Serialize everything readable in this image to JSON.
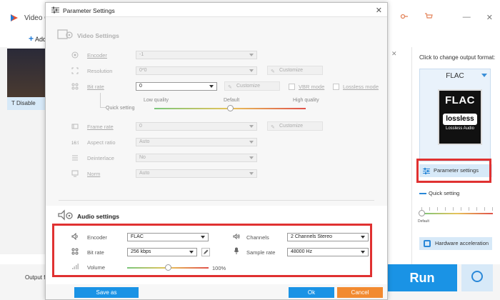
{
  "app": {
    "title": "Video C",
    "add_label": "Add",
    "disable_label": "Disable",
    "output_label": "Output fo",
    "run_label": "Run"
  },
  "right_panel": {
    "change_format_label": "Click to change output format:",
    "format_name": "FLAC",
    "format_icon_top": "FLAC",
    "format_icon_mid": "lossless",
    "format_icon_bottom": "Lossless Audio",
    "parameter_settings_label": "Parameter settings",
    "quick_setting_label": "Quick setting",
    "slider_default_label": "Default",
    "hardware_accel_label": "Hardware acceleration"
  },
  "dialog": {
    "title": "Parameter Settings",
    "close": "✕",
    "video": {
      "section_title": "Video Settings",
      "encoder_label": "Encoder",
      "encoder_value": "-1",
      "resolution_label": "Resolution",
      "resolution_value": "0*0",
      "resolution_customize": "Customize",
      "bitrate_label": "Bit rate",
      "bitrate_value": "0",
      "bitrate_customize": "Customize",
      "vbr_label": "VBR mode",
      "lossless_label": "Lossless mode",
      "quality_low": "Low quality",
      "quality_default": "Default",
      "quality_high": "High quality",
      "quick_setting_label": "Quick setting",
      "quick_setting_level": 0.5,
      "framerate_label": "Frame rate",
      "framerate_value": "0",
      "framerate_customize": "Customize",
      "aspect_label": "Aspect ratio",
      "aspect_value": "Auto",
      "deinterlace_label": "Deinterlace",
      "deinterlace_value": "No",
      "norm_label": "Norm",
      "norm_value": "Auto"
    },
    "audio": {
      "section_title": "Audio settings",
      "encoder_label": "Encoder",
      "encoder_value": "FLAC",
      "channels_label": "Channels",
      "channels_value": "2 Channels Stereo",
      "bitrate_label": "Bit rate",
      "bitrate_value": "256 kbps",
      "samplerate_label": "Sample rate",
      "samplerate_value": "48000 Hz",
      "volume_label": "Volume",
      "volume_value": "100%",
      "volume_level": 0.5
    },
    "save_as_label": "Save as",
    "ok_label": "Ok",
    "cancel_label": "Cancel"
  },
  "colors": {
    "accent": "#1a93e5",
    "highlight_box": "#e03131",
    "cancel": "#f28a30",
    "selected_bg": "#d7e9f8"
  }
}
